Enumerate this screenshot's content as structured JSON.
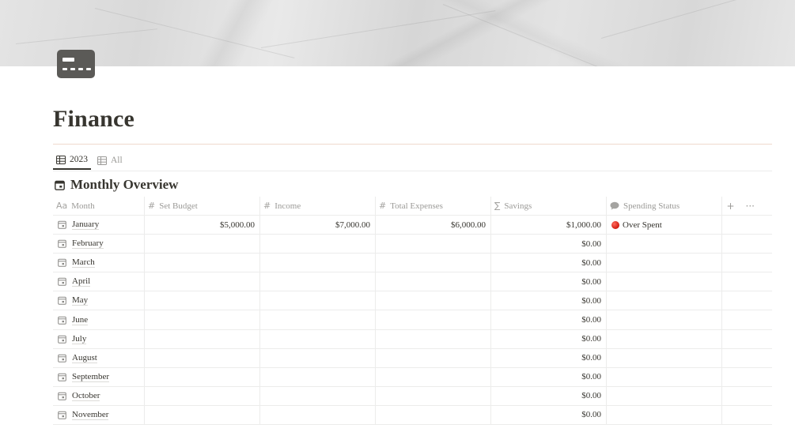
{
  "page": {
    "title": "Finance",
    "icon": "credit-card-icon"
  },
  "views": [
    {
      "label": "2023",
      "icon": "table-icon",
      "active": true
    },
    {
      "label": "All",
      "icon": "table-icon",
      "active": false
    }
  ],
  "database": {
    "title": "Monthly Overview",
    "icon": "calendar-icon"
  },
  "columns": [
    {
      "label": "Month",
      "glyph": "Aa"
    },
    {
      "label": "Set Budget",
      "glyph": "#"
    },
    {
      "label": "Income",
      "glyph": "#"
    },
    {
      "label": "Total Expenses",
      "glyph": "#"
    },
    {
      "label": "Savings",
      "glyph": "∑"
    },
    {
      "label": "Spending Status",
      "glyph": "speech-bubble-icon"
    }
  ],
  "header_actions": {
    "add": "+",
    "more": "···"
  },
  "rows": [
    {
      "month": "January",
      "budget": "$5,000.00",
      "income": "$7,000.00",
      "expenses": "$6,000.00",
      "savings": "$1,000.00",
      "status": "Over Spent"
    },
    {
      "month": "February",
      "budget": "",
      "income": "",
      "expenses": "",
      "savings": "$0.00",
      "status": ""
    },
    {
      "month": "March",
      "budget": "",
      "income": "",
      "expenses": "",
      "savings": "$0.00",
      "status": ""
    },
    {
      "month": "April",
      "budget": "",
      "income": "",
      "expenses": "",
      "savings": "$0.00",
      "status": ""
    },
    {
      "month": "May",
      "budget": "",
      "income": "",
      "expenses": "",
      "savings": "$0.00",
      "status": ""
    },
    {
      "month": "June",
      "budget": "",
      "income": "",
      "expenses": "",
      "savings": "$0.00",
      "status": ""
    },
    {
      "month": "July",
      "budget": "",
      "income": "",
      "expenses": "",
      "savings": "$0.00",
      "status": ""
    },
    {
      "month": "August",
      "budget": "",
      "income": "",
      "expenses": "",
      "savings": "$0.00",
      "status": ""
    },
    {
      "month": "September",
      "budget": "",
      "income": "",
      "expenses": "",
      "savings": "$0.00",
      "status": ""
    },
    {
      "month": "October",
      "budget": "",
      "income": "",
      "expenses": "",
      "savings": "$0.00",
      "status": ""
    },
    {
      "month": "November",
      "budget": "",
      "income": "",
      "expenses": "",
      "savings": "$0.00",
      "status": ""
    }
  ],
  "colors": {
    "text": "#37352f",
    "muted": "#9b9a97",
    "status_red": "#d11a0f",
    "accent_rule": "#f0d9cc"
  }
}
